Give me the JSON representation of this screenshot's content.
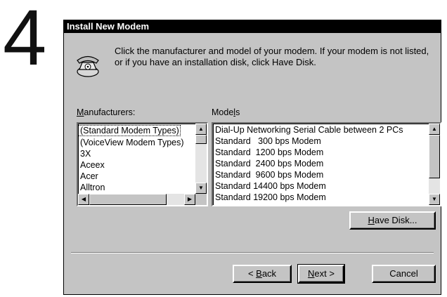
{
  "step_number": "4",
  "dialog": {
    "title": "Install New Modem",
    "instructions": "Click the manufacturer and model of your modem. If your modem is not listed, or if you have an installation disk, click Have Disk.",
    "manufacturers_label_mnemonic": "M",
    "manufacturers_label_rest": "anufacturers:",
    "models_label_pre": "Mode",
    "models_label_mnemonic": "l",
    "models_label_rest": "s",
    "manufacturers": [
      "(Standard Modem Types)",
      "(VoiceView Modem Types)",
      "3X",
      "Aceex",
      "Acer",
      "Alltron"
    ],
    "models": [
      "Dial-Up Networking Serial Cable between 2 PCs",
      "Standard   300 bps Modem",
      "Standard  1200 bps Modem",
      "Standard  2400 bps Modem",
      "Standard  9600 bps Modem",
      "Standard 14400 bps Modem",
      "Standard 19200 bps Modem"
    ],
    "have_disk_mnemonic": "H",
    "have_disk_rest": "ave Disk...",
    "back_prefix": "< ",
    "back_mnemonic": "B",
    "back_rest": "ack",
    "next_mnemonic": "N",
    "next_rest": "ext >",
    "cancel_label": "Cancel"
  }
}
